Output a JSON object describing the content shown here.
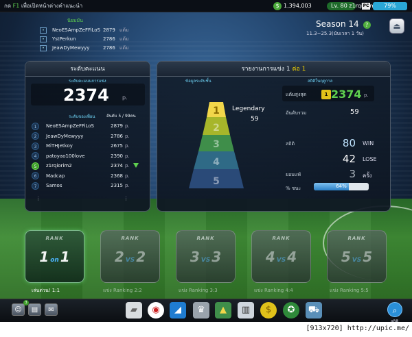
{
  "topbar": {
    "left_prefix": "กด",
    "left_highlight": "F1",
    "left_text": "เพื่อเปิดหน้าต่างคำแนะนำ",
    "money_icon": "coin-icon",
    "money": "1,394,003",
    "level": "Lv. 80",
    "username": "z1rqiorim2",
    "platform": "PC",
    "battery": "79%"
  },
  "ranklist_mini": {
    "heading": "นิยมมัน",
    "unit": "แต้ม",
    "rows": [
      {
        "name": "NeoESAmpZeFFiLoS",
        "points": "2879"
      },
      {
        "name": "YstPerkun",
        "points": "2786"
      },
      {
        "name": "JeawDyMewyyy",
        "points": "2786"
      }
    ]
  },
  "season": {
    "title": "Season 14",
    "help": "?",
    "dates": "11.3~25.3(นับเวลา 1 วัน)"
  },
  "left_panel": {
    "title": "ระดับคะแนน",
    "score_label": "ระดับคะแนนการแข่ง",
    "score": "2374",
    "score_unit": "p.",
    "ranking_label": "ระดับของเพื่อน",
    "current_rank": "อันดับ 5 / 99คน",
    "point_unit": "p.",
    "dots": "⋮",
    "rows": [
      {
        "rank": "1",
        "name": "NeoESAmpZeFFiLoS",
        "points": "2879"
      },
      {
        "rank": "2",
        "name": "JeawDyMewyyy",
        "points": "2786"
      },
      {
        "rank": "3",
        "name": "MiTHJetkoy",
        "points": "2675"
      },
      {
        "rank": "4",
        "name": "patoyao100love",
        "points": "2390"
      },
      {
        "rank": "5",
        "name": "z1rqiorim2",
        "points": "2374"
      },
      {
        "rank": "6",
        "name": "Madcap",
        "points": "2368"
      },
      {
        "rank": "7",
        "name": "Samos",
        "points": "2315"
      }
    ]
  },
  "right_panel": {
    "title": "รายงานการแข่ง 1",
    "title_highlight": "ต่อ 1",
    "tier_label": "ข้อมูลระดับชั้น",
    "stats_label": "สถิติในฤดูกาล",
    "tier_name": "Legendary",
    "tier_value": "59",
    "tier_levels": [
      "1",
      "2",
      "3",
      "4",
      "5"
    ],
    "best_label": "แต้มสูงสุด",
    "best_badge": "1",
    "best_value": "2374",
    "best_unit": "p.",
    "rank_label": "อันดับรวม",
    "rank_value": "59",
    "record_label": "สถิติ",
    "win_value": "80",
    "win_label": "WIN",
    "lose_value": "42",
    "lose_label": "LOSE",
    "draw_label": "ยอมแพ้",
    "draw_value": "3",
    "draw_unit": "ครั้ง",
    "winrate_label": "% ชนะ",
    "winrate": 64,
    "winrate_text": "64%"
  },
  "modes": [
    {
      "rank": "RANK",
      "left": "1",
      "vs": "on",
      "right": "1",
      "label": "เล่นด่วน! 1:1",
      "active": true
    },
    {
      "rank": "RANK",
      "left": "2",
      "vs": "VS",
      "right": "2",
      "label": "แข่ง Ranking 2:2",
      "active": false
    },
    {
      "rank": "RANK",
      "left": "3",
      "vs": "VS",
      "right": "3",
      "label": "แข่ง Ranking 3:3",
      "active": false
    },
    {
      "rank": "RANK",
      "left": "4",
      "vs": "VS",
      "right": "4",
      "label": "แข่ง Ranking 4:4",
      "active": false
    },
    {
      "rank": "RANK",
      "left": "5",
      "vs": "VS",
      "right": "5",
      "label": "แข่ง Ranking 5:5",
      "active": false
    }
  ],
  "bottombar": {
    "friends_badge": "3",
    "icons": [
      "friends-icon",
      "chat-icon",
      "mail-icon",
      "shoe-icon",
      "ball-icon",
      "boot-icon",
      "trophy-icon",
      "pyramid-icon",
      "cards-icon",
      "coin-icon",
      "club-icon",
      "cart-icon"
    ],
    "search_label": "สถิติ"
  },
  "footer": {
    "text": "[913x720] http://upic.me/"
  }
}
